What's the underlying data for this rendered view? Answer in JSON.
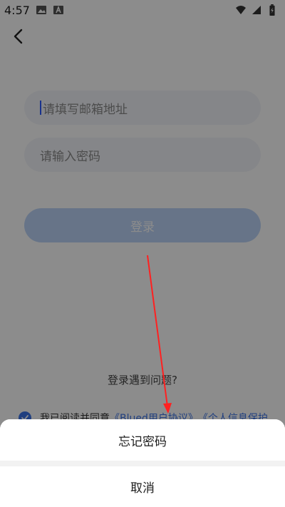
{
  "status_bar": {
    "time": "4:57",
    "icons_left": [
      "image-icon",
      "a-badge-icon"
    ],
    "icons_right": [
      "wifi-icon",
      "signal-icon",
      "battery-icon"
    ]
  },
  "login": {
    "email_placeholder": "请填写邮箱地址",
    "password_placeholder": "请输入密码",
    "login_button": "登录",
    "problem_link": "登录遇到问题?",
    "agreement_prefix": "我已阅读并同意",
    "agreement_link1": "《Blued用户协议》",
    "agreement_link2": "《个人信息保护"
  },
  "action_sheet": {
    "forgot_password": "忘记密码",
    "cancel": "取消"
  },
  "colors": {
    "accent": "#3b73e8",
    "annotation_arrow": "#ff2020"
  }
}
